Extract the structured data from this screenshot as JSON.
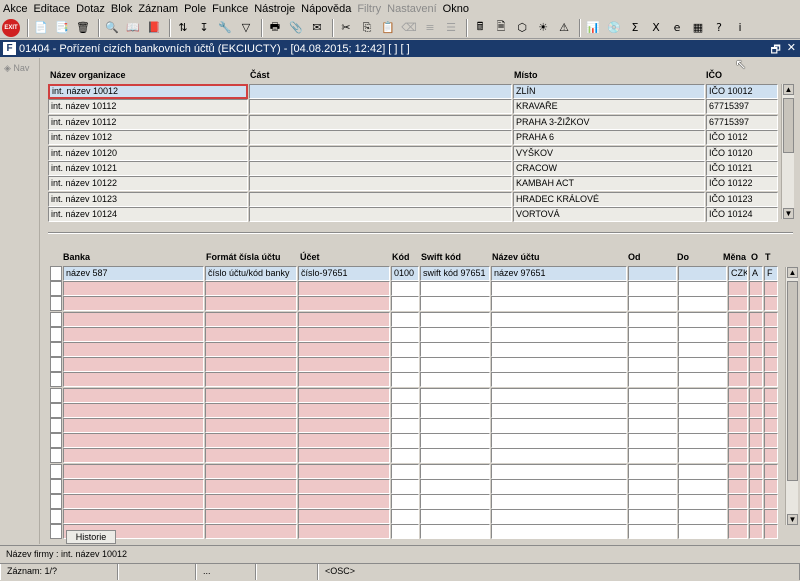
{
  "menu": [
    "Akce",
    "Editace",
    "Dotaz",
    "Blok",
    "Záznam",
    "Pole",
    "Funkce",
    "Nástroje",
    "Nápověda",
    "Filtry",
    "Nastavení",
    "Okno"
  ],
  "menu_disabled": [
    "Filtry",
    "Nastavení"
  ],
  "toolbar_exit_label": "EXIT",
  "window": {
    "logo": "F",
    "title": "01404 - Pořízení cizích bankovních účtů (EKCIUCTY) - [04.08.2015; 12:42] [ ] [ ]",
    "restore_glyph": "🗗",
    "close_glyph": "✕"
  },
  "nav_label": "Nav",
  "org_grid": {
    "columns": [
      "Název organizace",
      "Část",
      "Místo",
      "IČO"
    ],
    "rows": [
      [
        "int. název 10012",
        "",
        "ZLÍN",
        "IČO 10012"
      ],
      [
        "int. název 10112",
        "",
        "KRAVAŘE",
        "67715397"
      ],
      [
        "int. název 10112",
        "",
        "PRAHA 3-ŽIŽKOV",
        "67715397"
      ],
      [
        "int. název 1012",
        "",
        "PRAHA 6",
        "IČO 1012"
      ],
      [
        "int. název 10120",
        "",
        "VYŠKOV",
        "IČO 10120"
      ],
      [
        "int. název 10121",
        "",
        "CRACOW",
        "IČO 10121"
      ],
      [
        "int. název 10122",
        "",
        "KAMBAH ACT",
        "IČO 10122"
      ],
      [
        "int. název 10123",
        "",
        "HRADEC KRÁLOVÉ",
        "IČO 10123"
      ],
      [
        "int. název 10124",
        "",
        "VORTOVÁ",
        "IČO 10124"
      ]
    ]
  },
  "bank_grid": {
    "columns": [
      "Banka",
      "Formát čísla účtu",
      "Účet",
      "Kód",
      "Swift kód",
      "Název účtu",
      "Od",
      "Do",
      "Měna",
      "O",
      "T"
    ],
    "first_row": [
      "název 587",
      "číslo účtu/kód banky",
      "číslo-97651",
      "0100",
      "swift kód 97651",
      "název 97651",
      "",
      "",
      "CZK",
      "A",
      "F"
    ],
    "empty_rows": 17
  },
  "tab_label": "Historie",
  "status": {
    "firm": "Název firmy : int. název 10012",
    "record": "Záznam: 1/?",
    "seg2": "",
    "seg3": "...",
    "seg4": "",
    "mode": "<OSC>"
  }
}
